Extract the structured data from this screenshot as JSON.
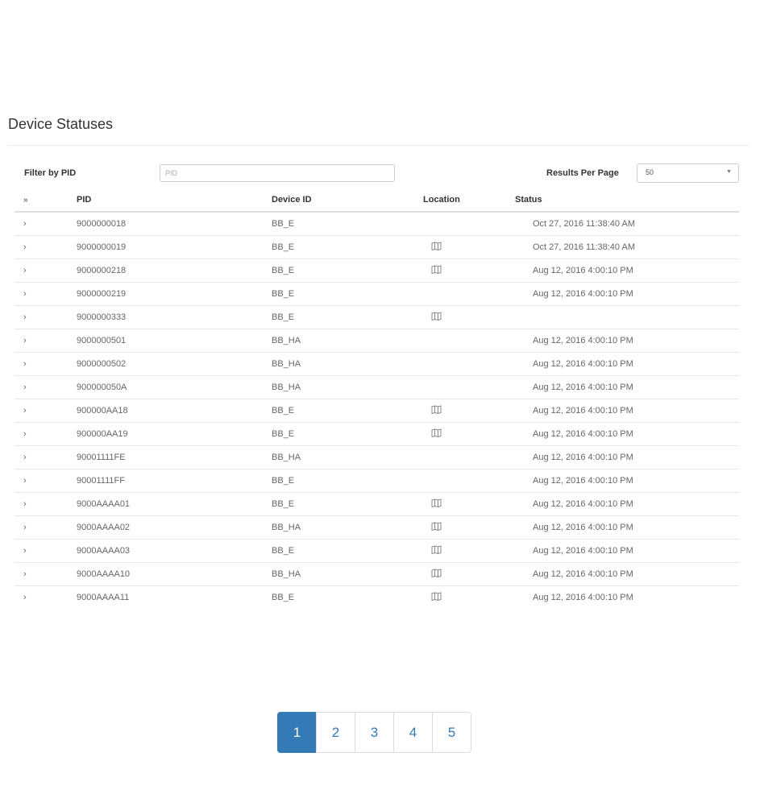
{
  "page": {
    "title": "Device Statuses"
  },
  "filter": {
    "label": "Filter by PID",
    "placeholder": "PID",
    "value": ""
  },
  "results_per_page": {
    "label": "Results Per Page",
    "value": "50"
  },
  "table": {
    "columns": {
      "expand": "»",
      "pid": "PID",
      "device_id": "Device ID",
      "location": "Location",
      "status": "Status"
    },
    "rows": [
      {
        "expand": "›",
        "pid": "9000000018",
        "device_id": "BB_E",
        "location_icon": false,
        "status": "Oct 27, 2016 11:38:40 AM"
      },
      {
        "expand": "›",
        "pid": "9000000019",
        "device_id": "BB_E",
        "location_icon": true,
        "status": "Oct 27, 2016 11:38:40 AM"
      },
      {
        "expand": "›",
        "pid": "9000000218",
        "device_id": "BB_E",
        "location_icon": true,
        "status": "Aug 12, 2016 4:00:10 PM"
      },
      {
        "expand": "›",
        "pid": "9000000219",
        "device_id": "BB_E",
        "location_icon": false,
        "status": "Aug 12, 2016 4:00:10 PM"
      },
      {
        "expand": "›",
        "pid": "9000000333",
        "device_id": "BB_E",
        "location_icon": true,
        "status": ""
      },
      {
        "expand": "›",
        "pid": "9000000501",
        "device_id": "BB_HA",
        "location_icon": false,
        "status": "Aug 12, 2016 4:00:10 PM"
      },
      {
        "expand": "›",
        "pid": "9000000502",
        "device_id": "BB_HA",
        "location_icon": false,
        "status": "Aug 12, 2016 4:00:10 PM"
      },
      {
        "expand": "›",
        "pid": "900000050A",
        "device_id": "BB_HA",
        "location_icon": false,
        "status": "Aug 12, 2016 4:00:10 PM"
      },
      {
        "expand": "›",
        "pid": "900000AA18",
        "device_id": "BB_E",
        "location_icon": true,
        "status": "Aug 12, 2016 4:00:10 PM"
      },
      {
        "expand": "›",
        "pid": "900000AA19",
        "device_id": "BB_E",
        "location_icon": true,
        "status": "Aug 12, 2016 4:00:10 PM"
      },
      {
        "expand": "›",
        "pid": "90001111FE",
        "device_id": "BB_HA",
        "location_icon": false,
        "status": "Aug 12, 2016 4:00:10 PM"
      },
      {
        "expand": "›",
        "pid": "90001111FF",
        "device_id": "BB_E",
        "location_icon": false,
        "status": "Aug 12, 2016 4:00:10 PM"
      },
      {
        "expand": "›",
        "pid": "9000AAAA01",
        "device_id": "BB_E",
        "location_icon": true,
        "status": "Aug 12, 2016 4:00:10 PM"
      },
      {
        "expand": "›",
        "pid": "9000AAAA02",
        "device_id": "BB_HA",
        "location_icon": true,
        "status": "Aug 12, 2016 4:00:10 PM"
      },
      {
        "expand": "›",
        "pid": "9000AAAA03",
        "device_id": "BB_E",
        "location_icon": true,
        "status": "Aug 12, 2016 4:00:10 PM"
      },
      {
        "expand": "›",
        "pid": "9000AAAA10",
        "device_id": "BB_HA",
        "location_icon": true,
        "status": "Aug 12, 2016 4:00:10 PM"
      },
      {
        "expand": "›",
        "pid": "9000AAAA11",
        "device_id": "BB_E",
        "location_icon": true,
        "status": "Aug 12, 2016 4:00:10 PM"
      }
    ],
    "location_icon_name": "map-icon"
  },
  "pagination": {
    "pages": [
      "1",
      "2",
      "3",
      "4",
      "5"
    ],
    "active": "1"
  },
  "colors": {
    "accent": "#337ab7",
    "rule": "#dddddd",
    "text": "#666666"
  }
}
